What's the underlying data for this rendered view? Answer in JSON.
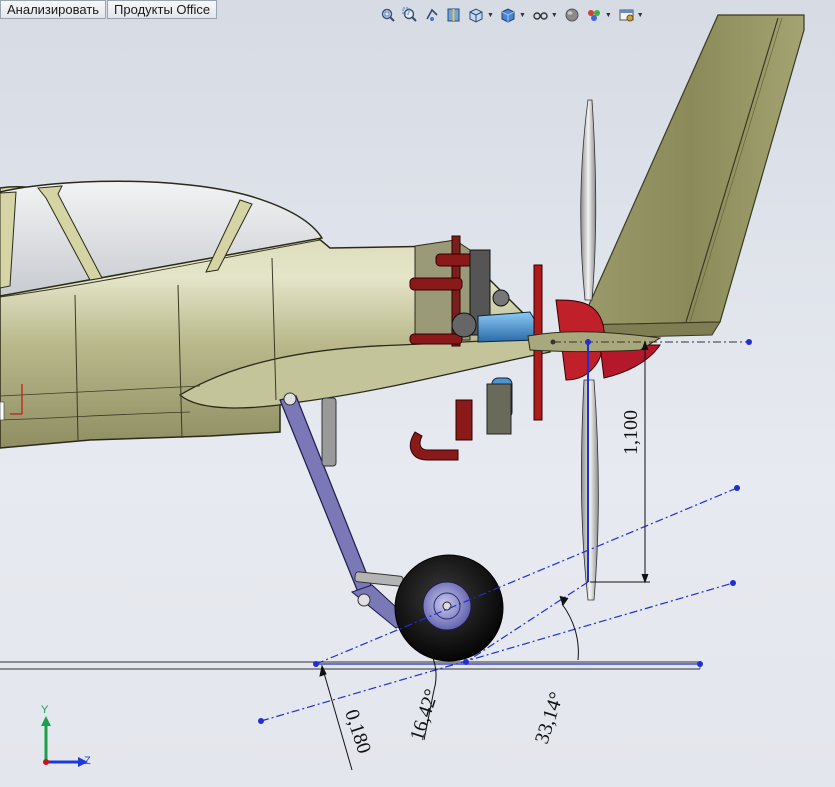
{
  "menu_tabs": [
    {
      "label": "Анализировать"
    },
    {
      "label": "Продукты Office"
    }
  ],
  "view_toolbar": {
    "icons": [
      "zoom-to-fit-icon",
      "zoom-to-area-icon",
      "previous-view-icon",
      "section-view-icon",
      "view-orientation-icon",
      "display-style-icon",
      "hide-show-items-icon",
      "edit-appearance-icon",
      "apply-scene-icon",
      "view-settings-icon"
    ]
  },
  "dimensions": {
    "vertical_distance": "1,100",
    "small_distance": "0,180",
    "angle_small": "16,42°",
    "angle_large": "33,14°"
  },
  "triad": {
    "y_label": "Y",
    "z_label": "Z"
  },
  "colors": {
    "fuselage": "#b9b98c",
    "tail": "#8c8c5c",
    "sketch_line": "#1f2fd0",
    "strut": "#7b78b8",
    "engine_red": "#8a1a1a",
    "tank_blue": "#4a9ad8",
    "spinner_red": "#c0202a"
  }
}
